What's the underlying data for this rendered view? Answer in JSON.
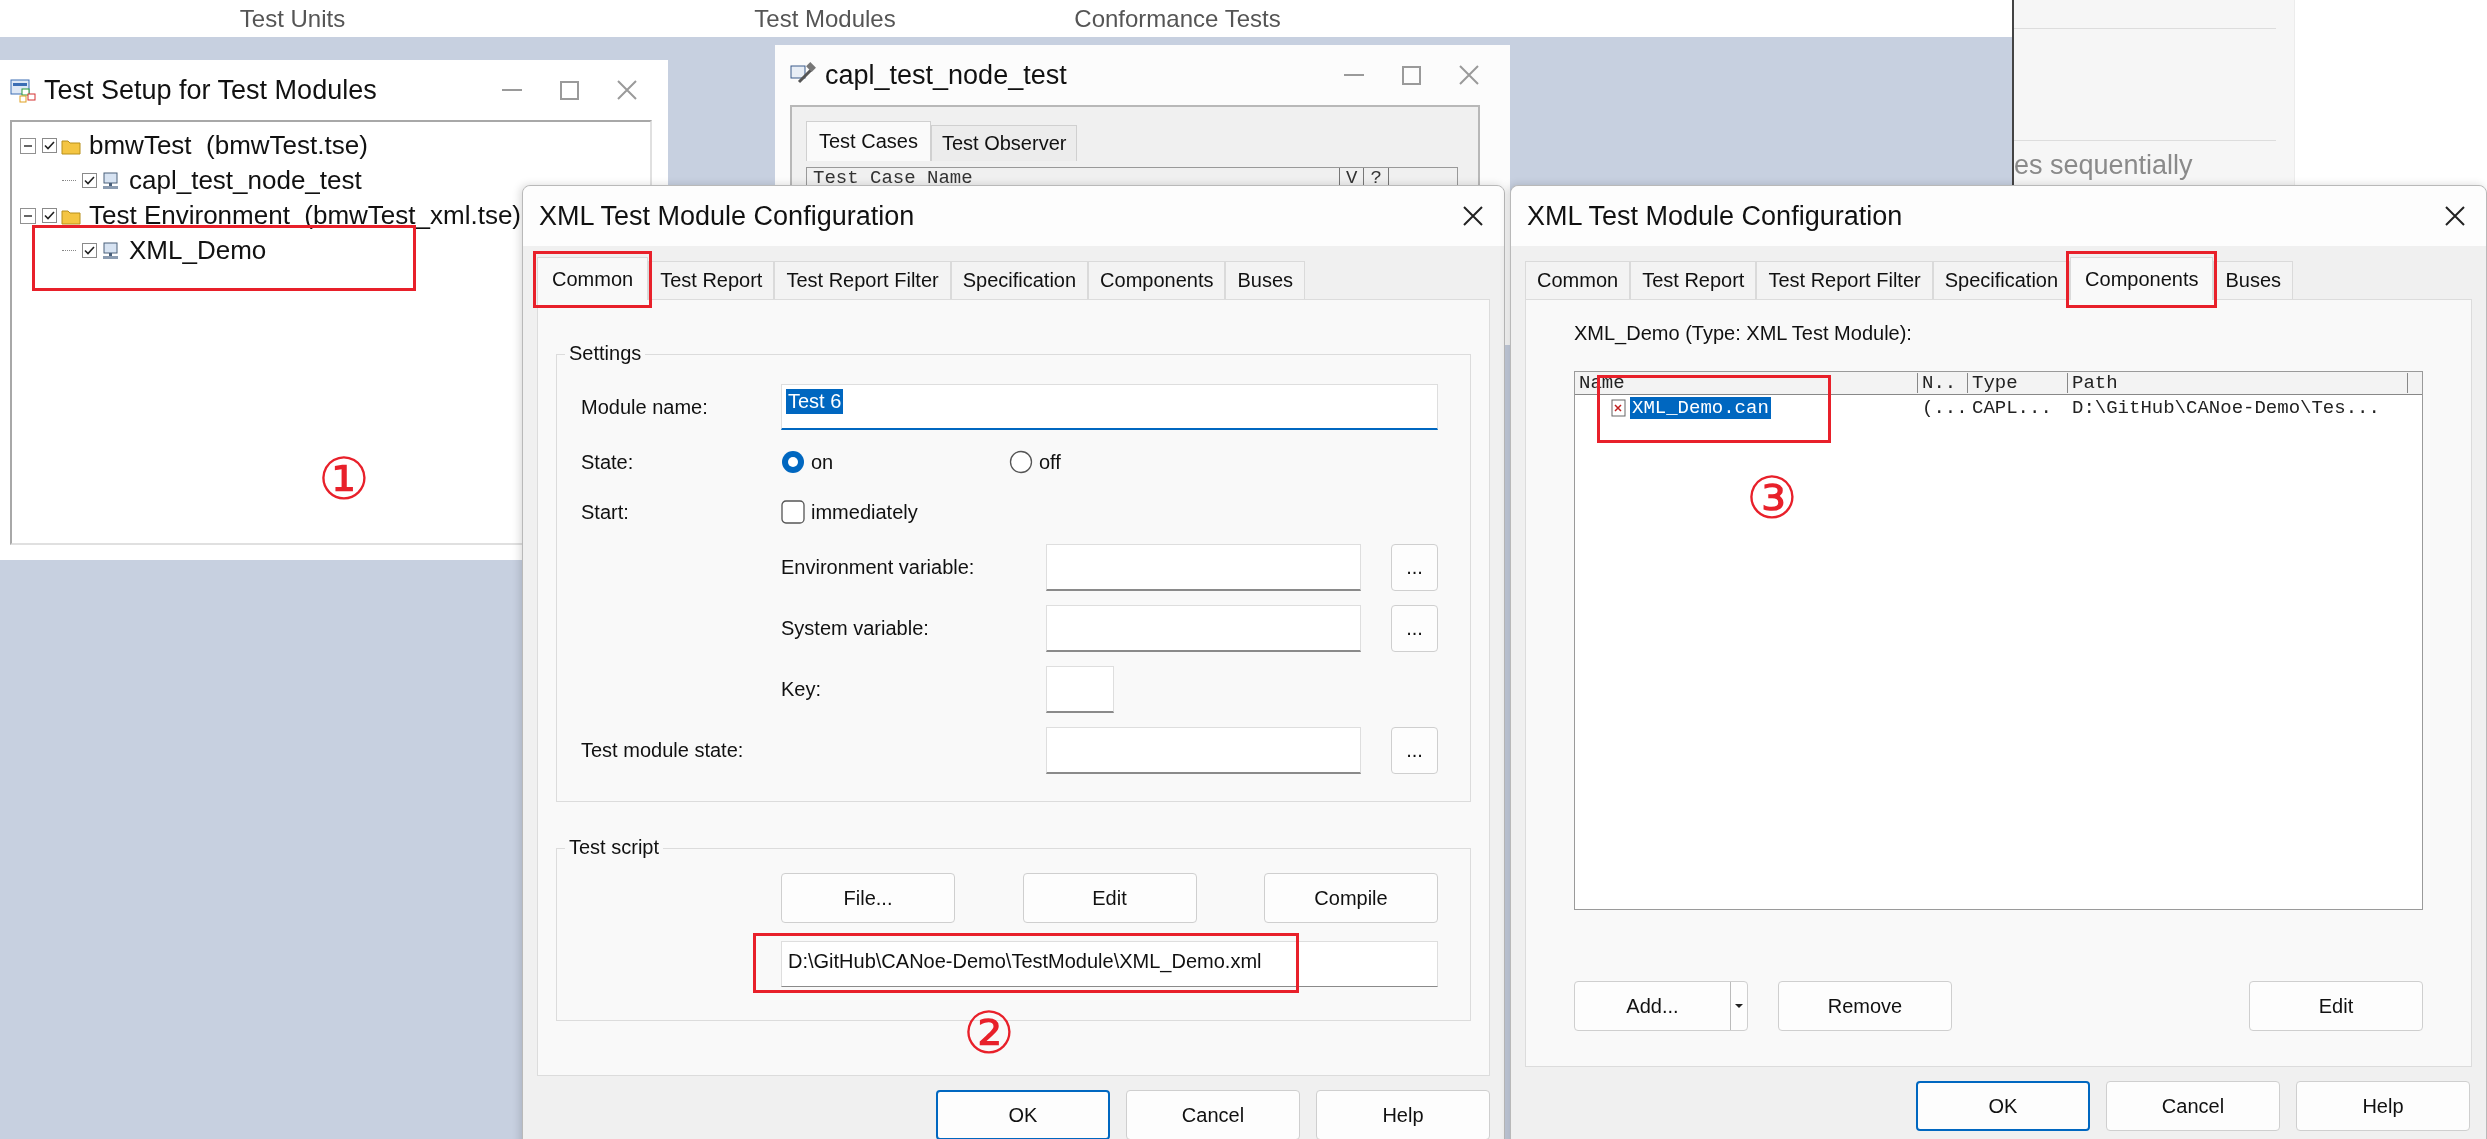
{
  "top_tabs": [
    {
      "label": "Test Units"
    },
    {
      "label": "Test Modules"
    },
    {
      "label": "Conformance Tests"
    }
  ],
  "background_panel": {
    "text": "es sequentially"
  },
  "test_setup_window": {
    "title": "Test Setup for Test Modules",
    "annotation_mark": "①",
    "tree": [
      {
        "label": "bmwTest  (bmwTest.tse)",
        "kind": "folder",
        "checked": true,
        "expanded": true,
        "annotated": false,
        "children": [
          {
            "label": "capl_test_node_test",
            "kind": "node",
            "checked": true,
            "annotated": false
          }
        ]
      },
      {
        "label": "Test Environment  (bmwTest_xml.tse)",
        "kind": "folder",
        "checked": true,
        "expanded": true,
        "annotated": false,
        "children": [
          {
            "label": "XML_Demo",
            "kind": "node",
            "checked": true,
            "annotated": true
          }
        ]
      }
    ]
  },
  "test_node_window": {
    "title": "capl_test_node_test",
    "tabs": [
      {
        "label": "Test Cases",
        "selected": true
      },
      {
        "label": "Test Observer",
        "selected": false
      }
    ],
    "columns": [
      "Test Case Name",
      "V",
      "?"
    ]
  },
  "common_dialog": {
    "title": "XML Test Module Configuration",
    "annotation_mark": "②",
    "tabs": [
      {
        "label": "Common",
        "selected": true,
        "annotated": true
      },
      {
        "label": "Test Report",
        "selected": false,
        "annotated": false
      },
      {
        "label": "Test Report Filter",
        "selected": false,
        "annotated": false
      },
      {
        "label": "Specification",
        "selected": false,
        "annotated": false
      },
      {
        "label": "Components",
        "selected": false,
        "annotated": false
      },
      {
        "label": "Buses",
        "selected": false,
        "annotated": false
      }
    ],
    "settings": {
      "label": "Settings",
      "rows": [
        {
          "kind": "text",
          "label": "Module name:",
          "value": "Test 6",
          "text_selected": true
        },
        {
          "kind": "radio",
          "label": "State:",
          "options": [
            {
              "label": "on",
              "selected": true
            },
            {
              "label": "off",
              "selected": false
            }
          ]
        },
        {
          "kind": "checkbox",
          "label": "Start:",
          "text": "immediately",
          "checked": false
        },
        {
          "kind": "subfield",
          "label": "Environment variable:",
          "browse": "..."
        },
        {
          "kind": "subfield",
          "label": "System variable:",
          "browse": "..."
        },
        {
          "kind": "key",
          "label": "Key:"
        },
        {
          "kind": "field",
          "label": "Test module state:",
          "browse": "..."
        }
      ]
    },
    "script": {
      "label": "Test script",
      "buttons": [
        "File...",
        "Edit",
        "Compile"
      ],
      "path": "D:\\GitHub\\CANoe-Demo\\TestModule\\XML_Demo.xml",
      "annotated": true
    },
    "buttons": [
      {
        "label": "OK",
        "default": true
      },
      {
        "label": "Cancel",
        "default": false
      },
      {
        "label": "Help",
        "default": false
      }
    ]
  },
  "components_dialog": {
    "title": "XML Test Module Configuration",
    "annotation_mark": "③",
    "tabs": [
      {
        "label": "Common",
        "selected": false,
        "annotated": false
      },
      {
        "label": "Test Report",
        "selected": false,
        "annotated": false
      },
      {
        "label": "Test Report Filter",
        "selected": false,
        "annotated": false
      },
      {
        "label": "Specification",
        "selected": false,
        "annotated": false
      },
      {
        "label": "Components",
        "selected": true,
        "annotated": true
      },
      {
        "label": "Buses",
        "selected": false,
        "annotated": false
      }
    ],
    "heading": "XML_Demo (Type: XML Test Module):",
    "list": {
      "columns": [
        "Name",
        "N..",
        "Type",
        "Path"
      ],
      "rows": [
        {
          "cells": [
            "XML_Demo.can",
            "(...",
            "CAPL...",
            "D:\\GitHub\\CANoe-Demo\\Tes..."
          ],
          "selected": true,
          "annotated": true
        }
      ]
    },
    "actions": [
      {
        "label": "Add...",
        "kind": "split"
      },
      {
        "label": "Remove",
        "kind": "plain"
      },
      {
        "label": "Edit",
        "kind": "plain"
      }
    ],
    "buttons": [
      {
        "label": "OK",
        "default": true
      },
      {
        "label": "Cancel",
        "default": false
      },
      {
        "label": "Help",
        "default": false
      }
    ]
  }
}
